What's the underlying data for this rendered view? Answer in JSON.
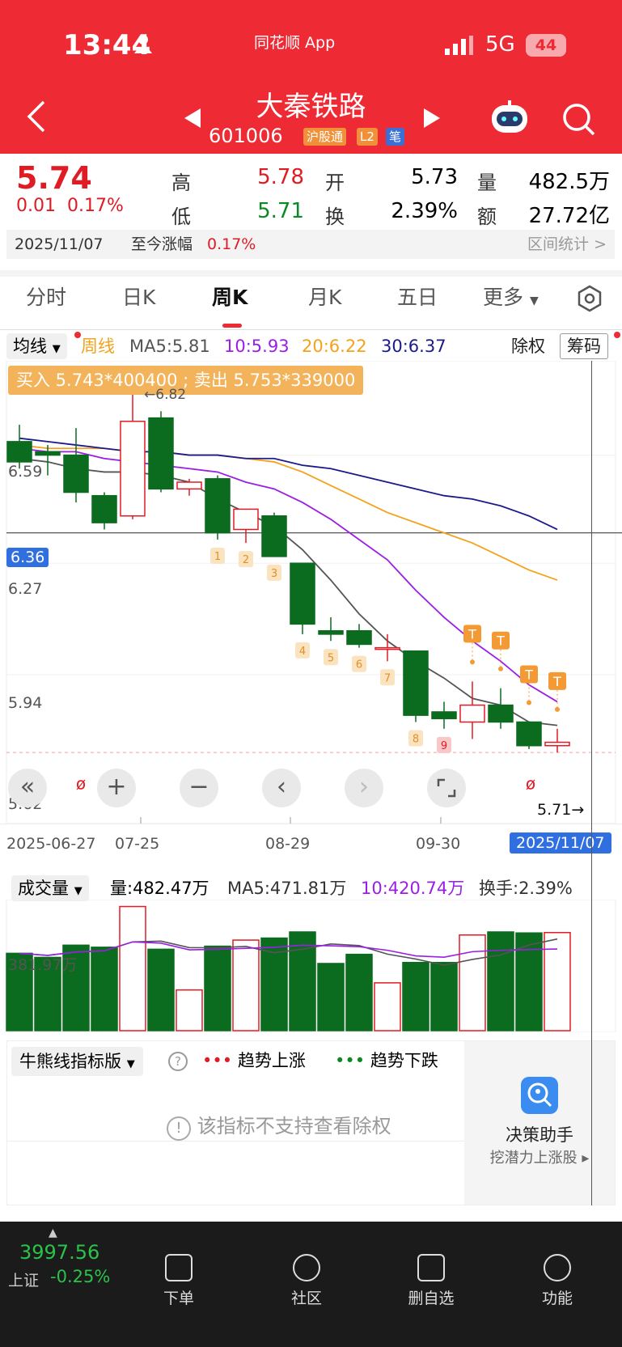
{
  "status_bar": {
    "time": "13:44",
    "app": "同花顺 App",
    "network": "5G",
    "battery": "44"
  },
  "header": {
    "title": "大秦铁路",
    "code": "601006",
    "tags": [
      "沪股通",
      "L2",
      "笔"
    ]
  },
  "quote": {
    "price": "5.74",
    "change": "0.01",
    "change_pct": "0.17%",
    "high_label": "高",
    "high": "5.78",
    "low_label": "低",
    "low": "5.71",
    "open_label": "开",
    "open": "5.73",
    "turnover_label": "换",
    "turnover": "2.39%",
    "volume_label": "量",
    "volume": "482.5万",
    "amount_label": "额",
    "amount": "27.72亿",
    "date": "2025/11/07",
    "since_label": "至今涨幅",
    "since_pct": "0.17%",
    "range_stats": "区间统计 >"
  },
  "tabs": [
    "分时",
    "日K",
    "周K",
    "月K",
    "五日",
    "更多"
  ],
  "active_tab": "周K",
  "ma_bar": {
    "selector": "均线",
    "period": "周线",
    "ma5": "MA5:5.81",
    "ma10": "10:5.93",
    "ma20": "20:6.22",
    "ma30": "30:6.37",
    "exright": "除权",
    "chips": "筹码"
  },
  "order_banner": "买入 5.743*400400 ; 卖出 5.753*339000",
  "price_axis": [
    "6.59",
    "6.36",
    "6.27",
    "5.94",
    "5.62"
  ],
  "annotations": {
    "high_mark": "6.82",
    "last_mark": "5.71"
  },
  "date_axis": [
    "2025-06-27",
    "07-25",
    "08-29",
    "09-30",
    "2025/11/07"
  ],
  "volume_panel": {
    "selector": "成交量",
    "vol": "量:482.47万",
    "ma5": "MA5:471.81万",
    "ma10": "10:420.74万",
    "turnover": "换手:2.39%",
    "axis": "381.97万"
  },
  "indicator": {
    "selector": "牛熊线指标版",
    "up": "趋势上涨",
    "down": "趋势下跌",
    "notice": "该指标不支持查看除权"
  },
  "assistant": {
    "title": "决策助手",
    "subtitle": "挖潜力上涨股"
  },
  "bottom": {
    "index_value": "3997.56",
    "index_name": "上证",
    "index_change": "-0.25%",
    "nav": [
      "下单",
      "社区",
      "删自选",
      "功能"
    ]
  },
  "colors": {
    "up": "#e01b24",
    "down": "#0b6b1f",
    "ma5": "#555555",
    "ma10": "#9b1ee6",
    "ma20": "#f4a21b",
    "ma30": "#1b1a8a"
  },
  "chart_data": {
    "type": "candlestick",
    "period": "weekly",
    "candles": [
      {
        "o": 6.63,
        "c": 6.57,
        "h": 6.68,
        "l": 6.55
      },
      {
        "o": 6.6,
        "c": 6.59,
        "h": 6.62,
        "l": 6.53
      },
      {
        "o": 6.59,
        "c": 6.48,
        "h": 6.67,
        "l": 6.45
      },
      {
        "o": 6.47,
        "c": 6.39,
        "h": 6.48,
        "l": 6.37
      },
      {
        "o": 6.41,
        "c": 6.69,
        "h": 6.82,
        "l": 6.4
      },
      {
        "o": 6.7,
        "c": 6.49,
        "h": 6.72,
        "l": 6.48
      },
      {
        "o": 6.49,
        "c": 6.51,
        "h": 6.52,
        "l": 6.47
      },
      {
        "o": 6.52,
        "c": 6.36,
        "h": 6.53,
        "l": 6.34
      },
      {
        "o": 6.37,
        "c": 6.43,
        "h": 6.43,
        "l": 6.33
      },
      {
        "o": 6.41,
        "c": 6.29,
        "h": 6.42,
        "l": 6.29
      },
      {
        "o": 6.27,
        "c": 6.09,
        "h": 6.27,
        "l": 6.06
      },
      {
        "o": 6.07,
        "c": 6.06,
        "h": 6.11,
        "l": 6.04
      },
      {
        "o": 6.07,
        "c": 6.03,
        "h": 6.09,
        "l": 6.02
      },
      {
        "o": 6.02,
        "c": 6.02,
        "h": 6.06,
        "l": 5.98
      },
      {
        "o": 6.01,
        "c": 5.82,
        "h": 6.01,
        "l": 5.8
      },
      {
        "o": 5.83,
        "c": 5.81,
        "h": 5.86,
        "l": 5.78
      },
      {
        "o": 5.8,
        "c": 5.85,
        "h": 5.92,
        "l": 5.75
      },
      {
        "o": 5.85,
        "c": 5.8,
        "h": 5.9,
        "l": 5.78
      },
      {
        "o": 5.8,
        "c": 5.73,
        "h": 5.8,
        "l": 5.72
      },
      {
        "o": 5.73,
        "c": 5.74,
        "h": 5.78,
        "l": 5.71
      }
    ],
    "ma": {
      "MA5": [
        6.58,
        6.57,
        6.55,
        6.54,
        6.54,
        6.53,
        6.51,
        6.46,
        6.42,
        6.38,
        6.31,
        6.22,
        6.12,
        6.04,
        5.98,
        5.93,
        5.87,
        5.85,
        5.8,
        5.79
      ],
      "MA10": [
        6.61,
        6.6,
        6.6,
        6.58,
        6.57,
        6.56,
        6.55,
        6.54,
        6.51,
        6.49,
        6.45,
        6.4,
        6.34,
        6.28,
        6.19,
        6.11,
        6.04,
        5.98,
        5.91,
        5.86
      ],
      "MA20": [
        6.62,
        6.61,
        6.61,
        6.61,
        6.6,
        6.6,
        6.59,
        6.59,
        6.58,
        6.57,
        6.54,
        6.5,
        6.46,
        6.42,
        6.39,
        6.36,
        6.33,
        6.29,
        6.25,
        6.22
      ],
      "MA30": [
        6.64,
        6.63,
        6.62,
        6.61,
        6.6,
        6.6,
        6.59,
        6.59,
        6.58,
        6.58,
        6.56,
        6.55,
        6.53,
        6.51,
        6.49,
        6.47,
        6.46,
        6.44,
        6.41,
        6.37
      ]
    },
    "signals": [
      {
        "index": 7,
        "label": "1"
      },
      {
        "index": 8,
        "label": "2"
      },
      {
        "index": 9,
        "label": "3"
      },
      {
        "index": 10,
        "label": "4"
      },
      {
        "index": 11,
        "label": "5"
      },
      {
        "index": 12,
        "label": "6"
      },
      {
        "index": 13,
        "label": "7"
      },
      {
        "index": 14,
        "label": "8"
      },
      {
        "index": 15,
        "label": "9"
      }
    ],
    "t_marks": [
      16,
      17,
      18,
      19
    ],
    "volumes": [
      380,
      360,
      420,
      410,
      610,
      400,
      200,
      415,
      445,
      455,
      485,
      330,
      375,
      235,
      335,
      335,
      470,
      485,
      480,
      482
    ],
    "ylim": [
      5.6,
      6.85
    ]
  }
}
